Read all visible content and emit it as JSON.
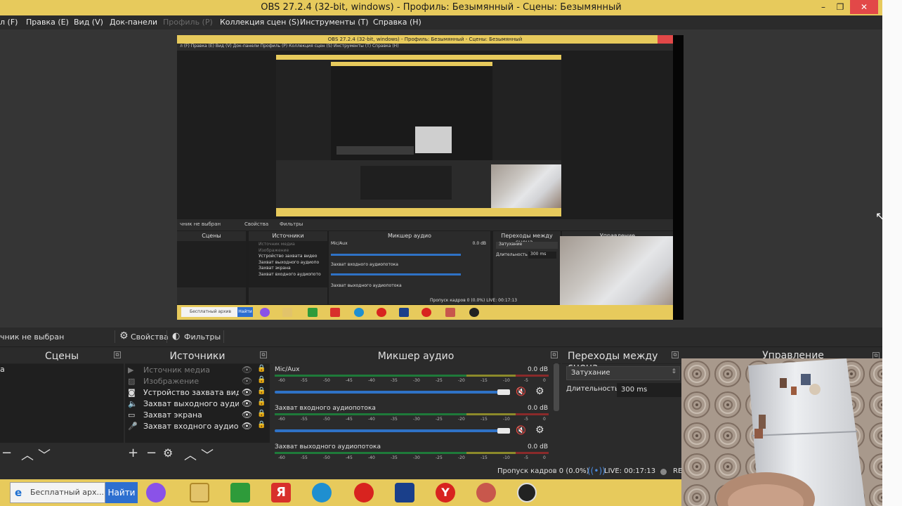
{
  "window": {
    "title": "OBS 27.2.4 (32-bit, windows) - Профиль: Безымянный - Сцены: Безымянный",
    "minimize": "–",
    "restore": "❐",
    "close": "✕"
  },
  "menu": {
    "file": "л (F)",
    "edit": "Правка (E)",
    "view": "Вид (V)",
    "docks": "Док-панели",
    "profile": "Профиль (P)",
    "scene_collection": "Коллекция сцен (S)",
    "tools": "Инструменты (T)",
    "help": "Справка (H)"
  },
  "nested_preview": {
    "title": "OBS 27.2.4 (32-bit, windows) - Профиль: Безымянный - Сцены: Безымянный",
    "menu": "л (F)    Правка (E)    Вид (V)    Док-панели    Профиль (P)    Коллекция сцен (S)    Инструменты (T)    Справка (H)",
    "status_left": "чник не выбран",
    "btn_props": "Свойства",
    "btn_filters": "Фильтры",
    "scenes": "Сцены",
    "sources": "Источники",
    "mixer": "Микшер аудио",
    "transitions": "Переходы между сцена...",
    "controls": "Управление",
    "src_items": [
      "Источник медиа",
      "Изображение",
      "Устройство захвата видео",
      "Захват выходного аудиопо",
      "Захват экрана",
      "Захват входного аудиопото"
    ],
    "mic": "Mic/Aux",
    "mic_db": "0.0 dB",
    "ch2": "Захват входного аудиопотока",
    "ch3": "Захват выходного аудиопотока",
    "fade": "Затухание",
    "dur_label": "Длительность",
    "dur_val": "300 ms",
    "status_right": "Пропуск кадров 0 (0.0%)   LIVE: 00:17:13",
    "search": "Бесплатный архив",
    "find": "Найти"
  },
  "status_strip": {
    "no_source": "чник не выбран",
    "properties": "Свойства",
    "filters": "Фильтры"
  },
  "docks": {
    "scenes": {
      "title": "Сцены",
      "item": "а"
    },
    "sources": {
      "title": "Источники",
      "items": [
        {
          "label": "Источник медиа",
          "icon": "▶"
        },
        {
          "label": "Изображение",
          "icon": "▨"
        },
        {
          "label": "Устройство захвата видео",
          "icon": "◙"
        },
        {
          "label": "Захват выходного аудиопото",
          "icon": "🔈"
        },
        {
          "label": "Захват экрана",
          "icon": "▭"
        },
        {
          "label": "Захват входного аудиопото",
          "icon": "🎤"
        }
      ]
    },
    "mixer": {
      "title": "Микшер аудио",
      "channels": [
        {
          "name": "Mic/Aux",
          "db": "0.0 dB"
        },
        {
          "name": "Захват входного аудиопотока",
          "db": "0.0 dB"
        },
        {
          "name": "Захват выходного аудиопотока",
          "db": "0.0 dB"
        }
      ],
      "scale": [
        "-60",
        "-55",
        "-50",
        "-45",
        "-40",
        "-35",
        "-30",
        "-25",
        "-20",
        "-15",
        "-10",
        "-5",
        "0"
      ]
    },
    "transitions": {
      "title": "Переходы между сцена...",
      "selected": "Затухание",
      "duration_label": "Длительность",
      "duration_value": "300 ms"
    },
    "controls": {
      "title": "Управление"
    }
  },
  "statusbar": {
    "dropped": "Пропуск кадров 0 (0.0%)",
    "live": "LIVE: 00:17:13",
    "rec": "RE"
  },
  "taskbar": {
    "search_text": "Бесплатный арх...",
    "find_label": "Найти"
  },
  "colors": {
    "accent": "#e7ca5c",
    "close_red": "#e24848",
    "panel": "#2b2b2b",
    "list_bg": "#1f1f1f",
    "slider_blue": "#2f72c6",
    "mute_red": "#d23030"
  }
}
